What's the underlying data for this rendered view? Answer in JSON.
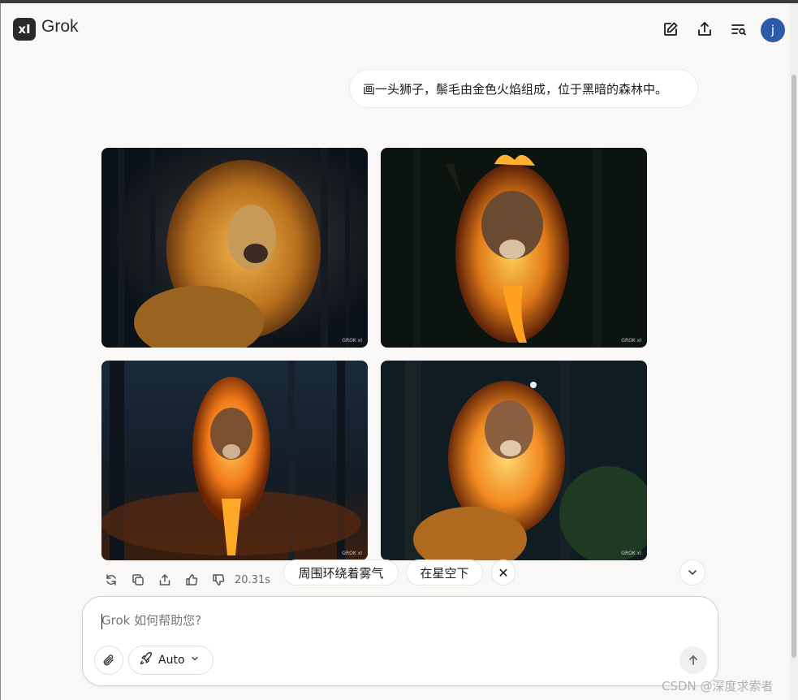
{
  "header": {
    "logo_text": "xI",
    "brand": "Grok",
    "avatar_initial": "j",
    "icons": [
      "edit-icon",
      "share-icon",
      "history-search-icon"
    ]
  },
  "chat": {
    "user_message": "画一头狮子，鬃毛由金色火焰组成，位于黑暗的森林中。",
    "images": [
      {
        "alt": "lion with golden mane",
        "watermark": "GROK xI"
      },
      {
        "alt": "lion with flaming mane",
        "watermark": "GROK xI"
      },
      {
        "alt": "standing lion engulfed in flames",
        "watermark": "GROK xI"
      },
      {
        "alt": "sitting lion with fiery mane",
        "watermark": "GROK xI"
      }
    ],
    "response_time": "20.31s",
    "suggestions": [
      "周围环绕着雾气",
      "在星空下"
    ],
    "close_symbol": "✕"
  },
  "composer": {
    "placeholder": "Grok 如何帮助您?",
    "mode_label": "Auto"
  },
  "watermark": "CSDN @深度求索者",
  "colors": {
    "background": "#f9f8f6",
    "avatar": "#2c5aa8",
    "forest": "#0c1622",
    "flame": "#e8951f"
  }
}
